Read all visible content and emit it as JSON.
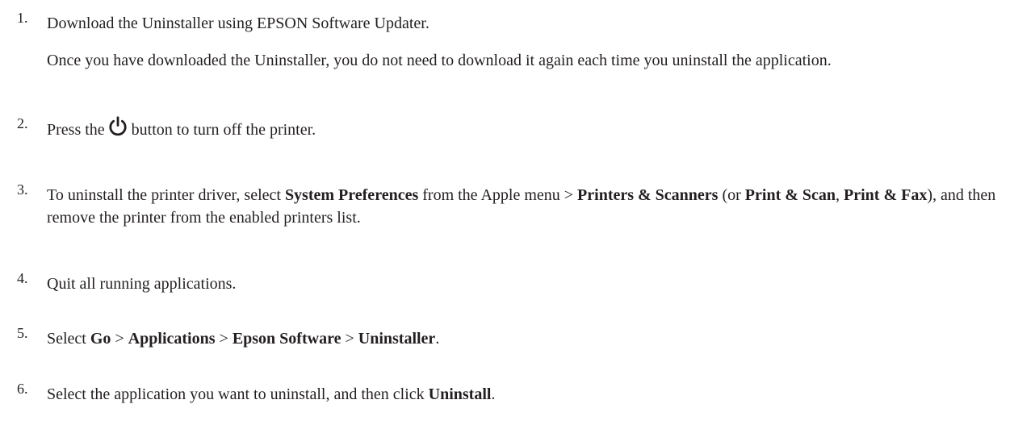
{
  "steps": [
    {
      "number": "1.",
      "text": "Download the Uninstaller using EPSON Software Updater.",
      "note": "Once you have downloaded the Uninstaller, you do not need to download it again each time you uninstall the application."
    },
    {
      "number": "2.",
      "text_before": "Press the",
      "icon": "power-icon",
      "text_after": "button to turn off the printer."
    },
    {
      "number": "3.",
      "segments": [
        {
          "t": "To uninstall the printer driver, select "
        },
        {
          "b": "System Preferences"
        },
        {
          "t": " from the Apple menu > "
        },
        {
          "b": "Printers & Scanners"
        },
        {
          "t": " (or "
        },
        {
          "b": "Print & Scan"
        },
        {
          "t": ", "
        },
        {
          "b": "Print & Fax"
        },
        {
          "t": "), and then remove the printer from the enabled printers list."
        }
      ]
    },
    {
      "number": "4.",
      "text": "Quit all running applications."
    },
    {
      "number": "5.",
      "segments": [
        {
          "t": "Select "
        },
        {
          "b": "Go"
        },
        {
          "t": " > "
        },
        {
          "b": "Applications"
        },
        {
          "t": " > "
        },
        {
          "b": "Epson Software"
        },
        {
          "t": " > "
        },
        {
          "b": "Uninstaller"
        },
        {
          "t": "."
        }
      ]
    },
    {
      "number": "6.",
      "segments": [
        {
          "t": "Select the application you want to uninstall, and then click "
        },
        {
          "b": "Uninstall"
        },
        {
          "t": "."
        }
      ]
    }
  ]
}
